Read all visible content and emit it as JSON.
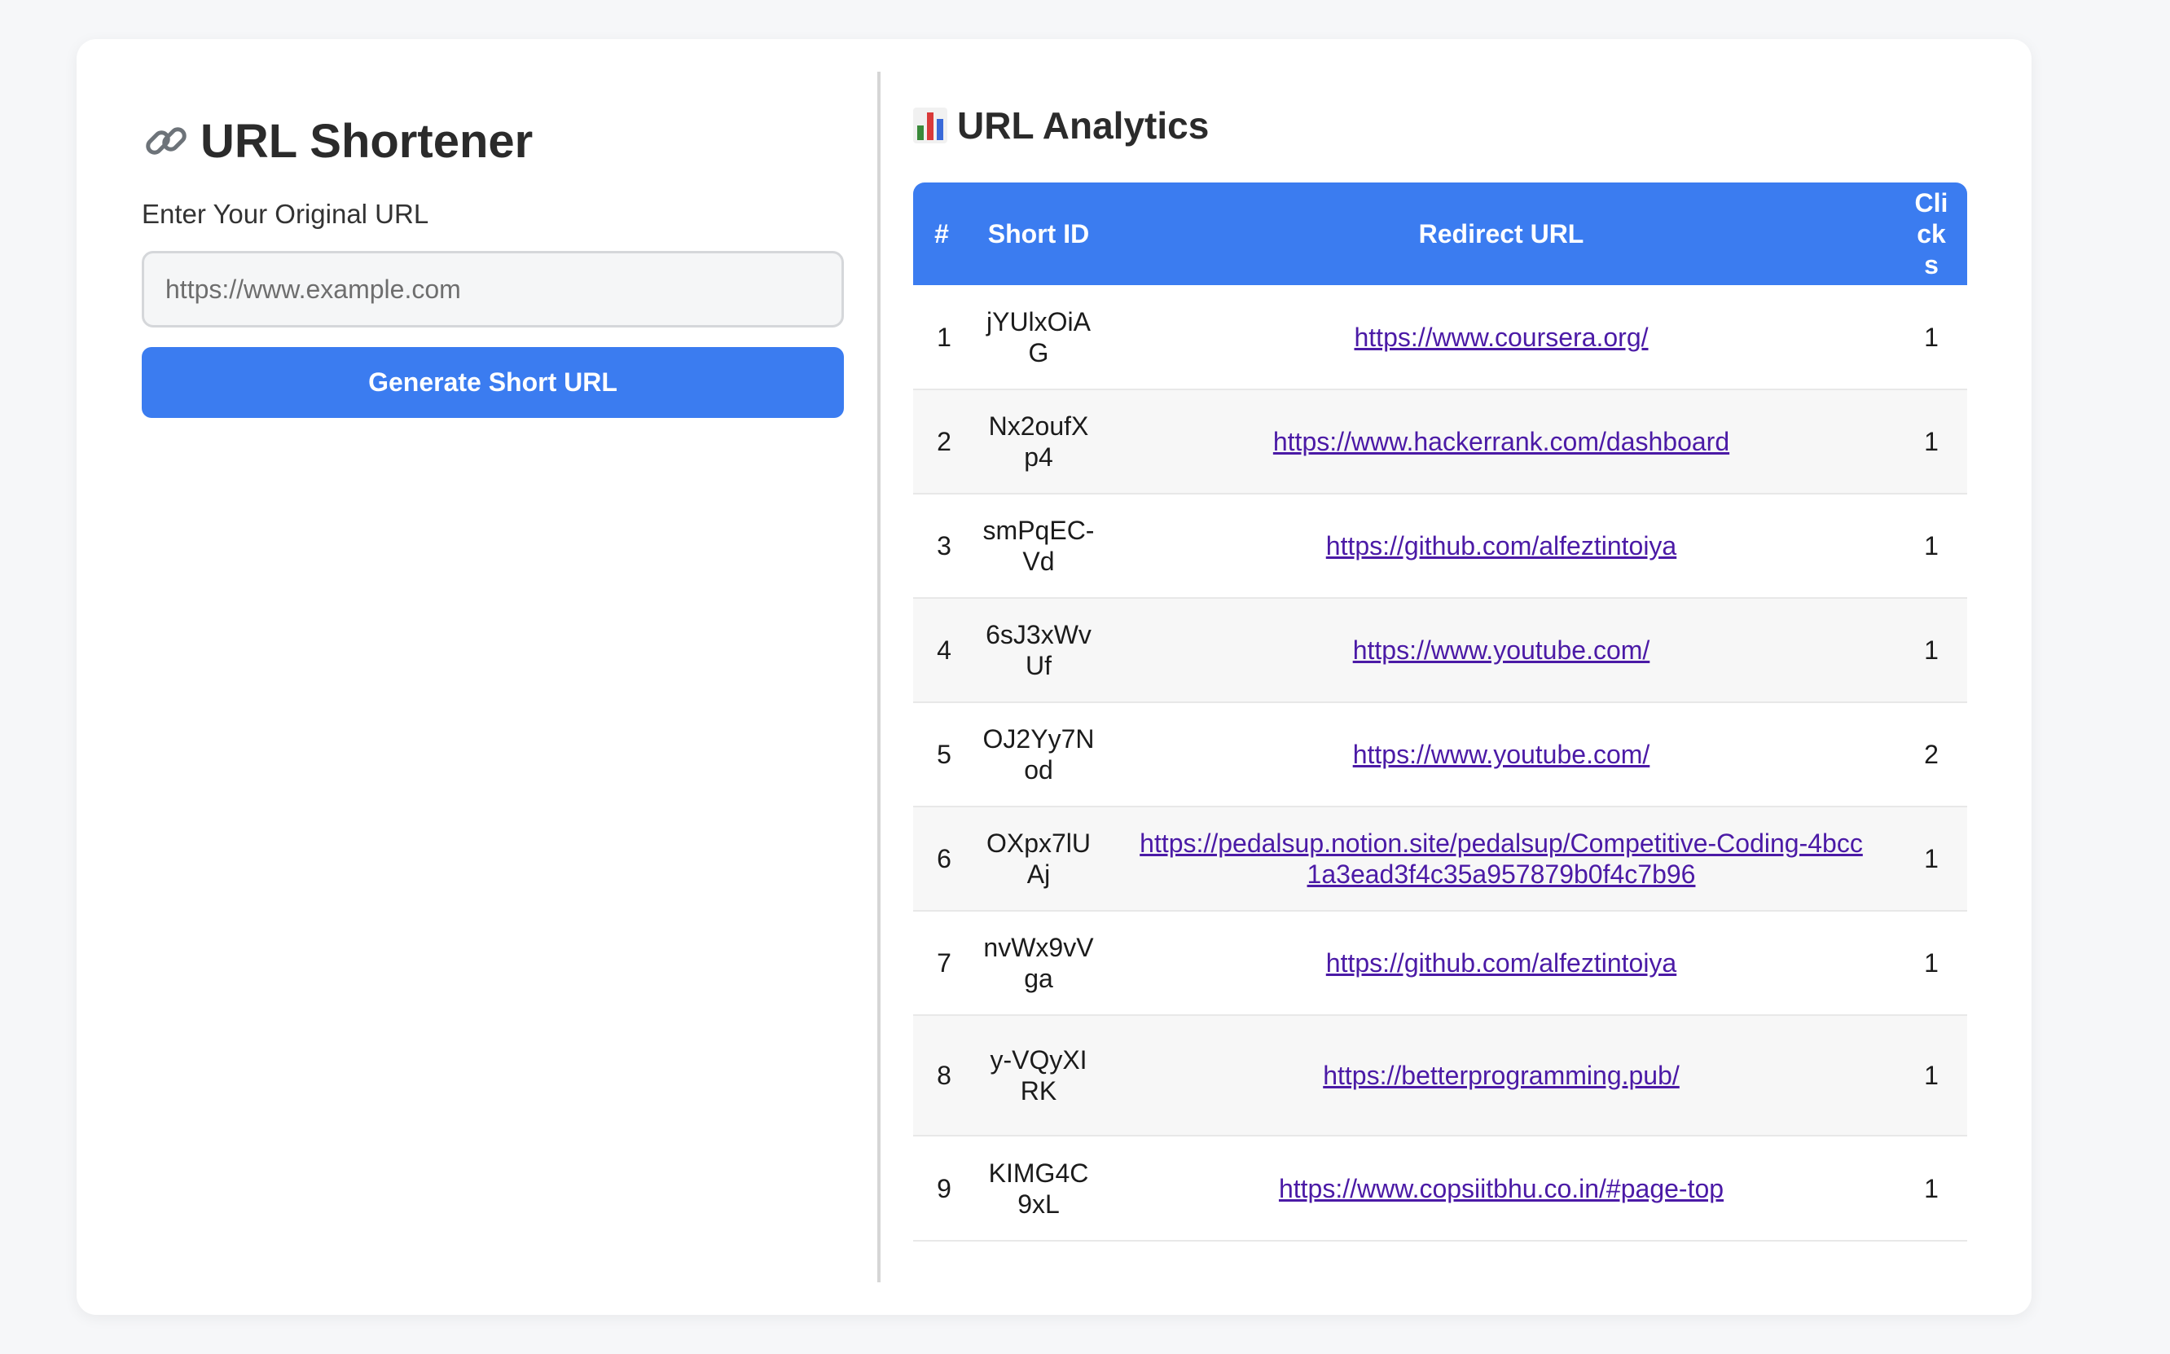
{
  "shortener": {
    "title": "URL Shortener",
    "input_label": "Enter Your Original URL",
    "input_placeholder": "https://www.example.com",
    "input_value": "",
    "button_label": "Generate Short URL"
  },
  "analytics": {
    "title": "URL Analytics",
    "columns": [
      "#",
      "Short ID",
      "Redirect URL",
      "Clicks"
    ],
    "rows": [
      {
        "num": "1",
        "short_id": "jYUlxOiAG",
        "url": "https://www.coursera.org/",
        "clicks": "1"
      },
      {
        "num": "2",
        "short_id": "Nx2oufXp4",
        "url": "https://www.hackerrank.com/dashboard",
        "clicks": "1"
      },
      {
        "num": "3",
        "short_id": "smPqEC-Vd",
        "url": "https://github.com/alfeztintoiya",
        "clicks": "1"
      },
      {
        "num": "4",
        "short_id": "6sJ3xWvUf",
        "url": "https://www.youtube.com/",
        "clicks": "1"
      },
      {
        "num": "5",
        "short_id": "OJ2Yy7Nod",
        "url": "https://www.youtube.com/",
        "clicks": "2"
      },
      {
        "num": "6",
        "short_id": "OXpx7lUAj",
        "url": "https://pedalsup.notion.site/pedalsup/Competitive-Coding-4bcc1a3ead3f4c35a957879b0f4c7b96",
        "clicks": "1"
      },
      {
        "num": "7",
        "short_id": "nvWx9vVga",
        "url": "https://github.com/alfeztintoiya",
        "clicks": "1"
      },
      {
        "num": "8",
        "short_id": "y-VQyXIRK",
        "url": "https://betterprogramming.pub/",
        "clicks": "1"
      },
      {
        "num": "9",
        "short_id": "KIMG4C9xL",
        "url": "https://www.copsiitbhu.co.in/#page-top",
        "clicks": "1"
      }
    ]
  },
  "icons": {
    "title_icon": "link-icon",
    "analytics_icon": "bar-chart-icon"
  },
  "colors": {
    "accent": "#3b7cf0",
    "link": "#4b1aa6"
  }
}
